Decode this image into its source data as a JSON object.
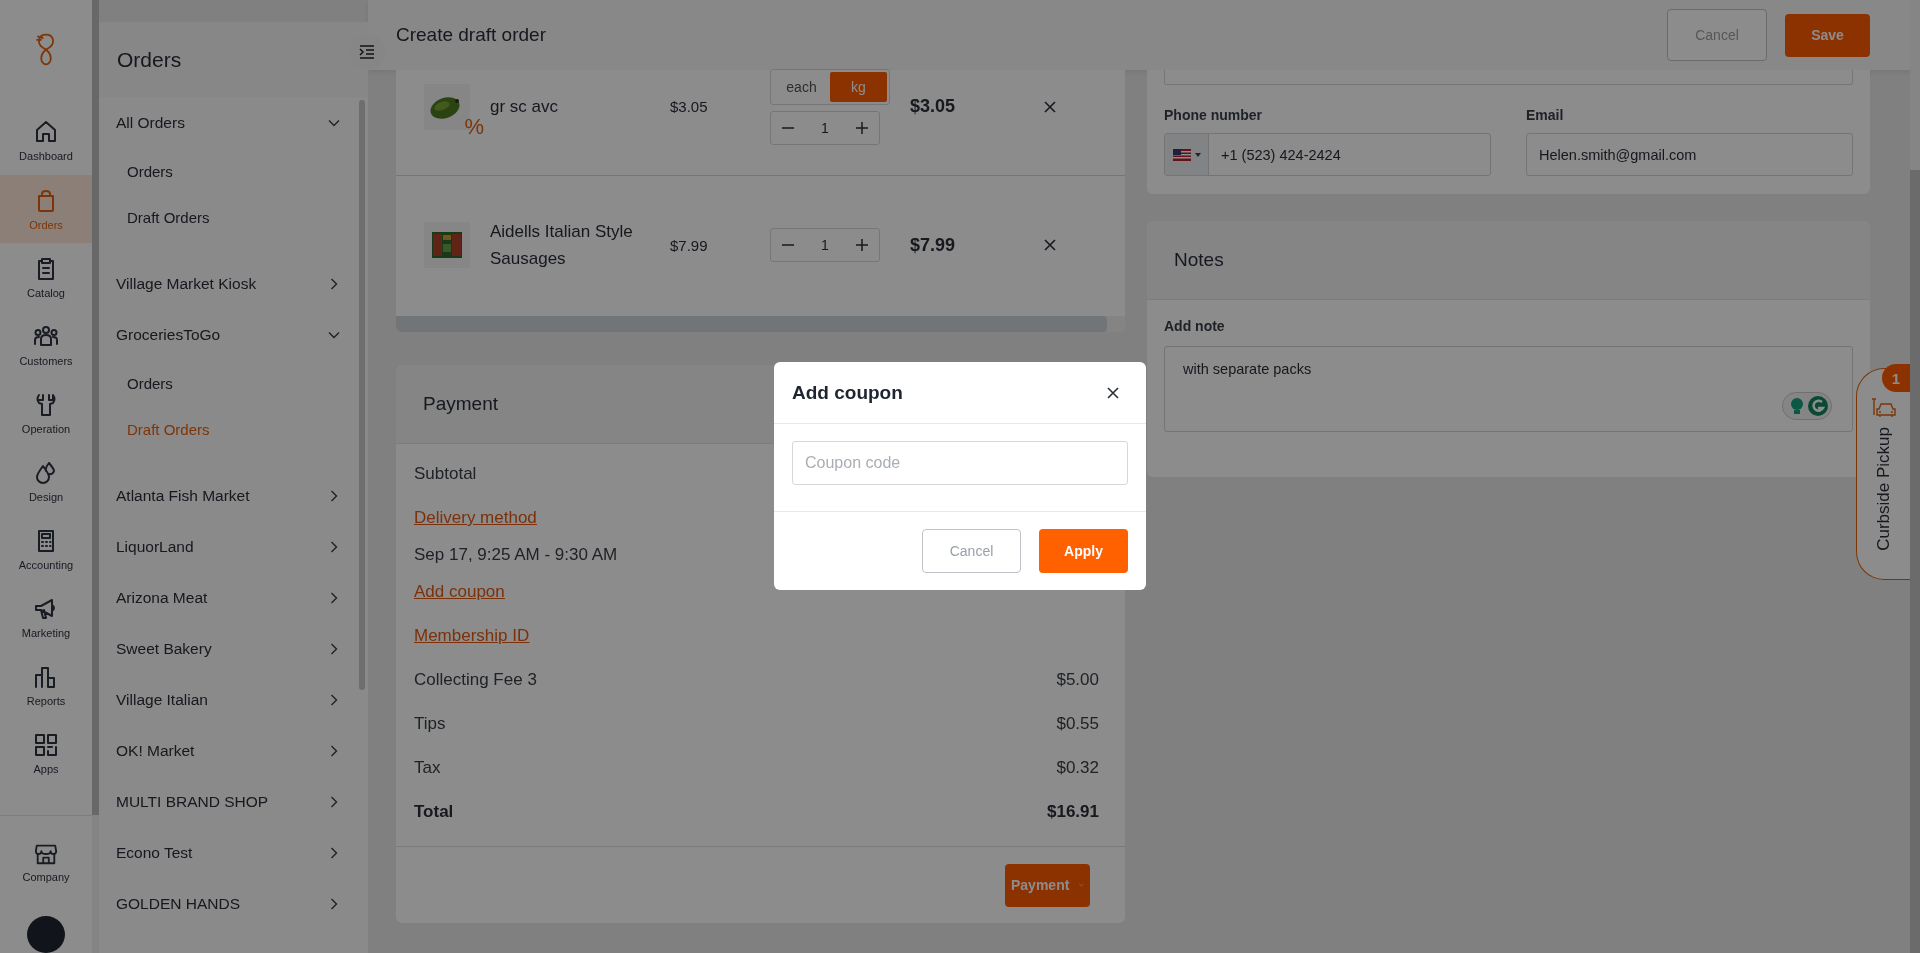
{
  "rail": {
    "items": [
      {
        "label": "Dashboard",
        "selected": false
      },
      {
        "label": "Orders",
        "selected": true
      },
      {
        "label": "Catalog",
        "selected": false
      },
      {
        "label": "Customers",
        "selected": false
      },
      {
        "label": "Operation",
        "selected": false
      },
      {
        "label": "Design",
        "selected": false
      },
      {
        "label": "Accounting",
        "selected": false
      },
      {
        "label": "Marketing",
        "selected": false
      },
      {
        "label": "Reports",
        "selected": false
      },
      {
        "label": "Apps",
        "selected": false
      }
    ],
    "bottom": {
      "label": "Company"
    }
  },
  "sidebar": {
    "title": "Orders",
    "groups": [
      {
        "label": "All Orders",
        "expanded": true,
        "children": [
          {
            "label": "Orders",
            "selected": false
          },
          {
            "label": "Draft Orders",
            "selected": false
          }
        ]
      },
      {
        "label": "Village Market Kiosk",
        "expanded": false
      },
      {
        "label": "GroceriesToGo",
        "expanded": true,
        "children": [
          {
            "label": "Orders",
            "selected": false
          },
          {
            "label": "Draft Orders",
            "selected": true
          }
        ]
      },
      {
        "label": "Atlanta Fish Market",
        "expanded": false
      },
      {
        "label": "LiquorLand",
        "expanded": false
      },
      {
        "label": "Arizona Meat",
        "expanded": false
      },
      {
        "label": "Sweet Bakery",
        "expanded": false
      },
      {
        "label": "Village Italian",
        "expanded": false
      },
      {
        "label": "OK! Market",
        "expanded": false
      },
      {
        "label": "MULTI BRAND SHOP",
        "expanded": false
      },
      {
        "label": "Econo Test",
        "expanded": false
      },
      {
        "label": "GOLDEN HANDS",
        "expanded": false
      }
    ]
  },
  "header": {
    "title": "Create draft order",
    "buttons": [
      {
        "label": "Cancel",
        "kind": "secondary"
      },
      {
        "label": "Save",
        "kind": "primary"
      }
    ]
  },
  "products": [
    {
      "name": "gr sc avc",
      "price": "$3.05",
      "badge": "%",
      "units": [
        {
          "label": "each",
          "selected": false
        },
        {
          "label": "kg",
          "selected": true
        }
      ],
      "quantity": "1",
      "total": "$3.05"
    },
    {
      "name": "Aidells Italian Style Sausages",
      "price": "$7.99",
      "quantity": "1",
      "total": "$7.99"
    }
  ],
  "customer": {
    "phone": {
      "label": "Phone number",
      "value": "+1 (523) 424-2424"
    },
    "email": {
      "label": "Email",
      "value": "Helen.smith@gmail.com"
    }
  },
  "payment": {
    "title": "Payment",
    "rows": [
      {
        "kind": "label",
        "label": "Subtotal"
      },
      {
        "kind": "link",
        "label": "Delivery method"
      },
      {
        "kind": "text",
        "label": "Sep 17, 9:25 AM - 9:30 AM"
      },
      {
        "kind": "link",
        "label": "Add coupon"
      },
      {
        "kind": "link",
        "label": "Membership ID"
      },
      {
        "kind": "line",
        "label": "Collecting Fee 3",
        "value": "$5.00"
      },
      {
        "kind": "line",
        "label": "Tips",
        "value": "$0.55"
      },
      {
        "kind": "line",
        "label": "Tax",
        "value": "$0.32"
      },
      {
        "kind": "total",
        "label": "Total",
        "value": "$16.91"
      }
    ],
    "button": "Payment"
  },
  "notes": {
    "title": "Notes",
    "label": "Add note",
    "value": "with separate packs"
  },
  "curbside": {
    "label": "Curbside Pickup",
    "badge": "1"
  },
  "modal": {
    "title": "Add coupon",
    "placeholder": "Coupon code",
    "buttons": [
      {
        "label": "Cancel",
        "kind": "secondary"
      },
      {
        "label": "Apply",
        "kind": "primary"
      }
    ]
  }
}
